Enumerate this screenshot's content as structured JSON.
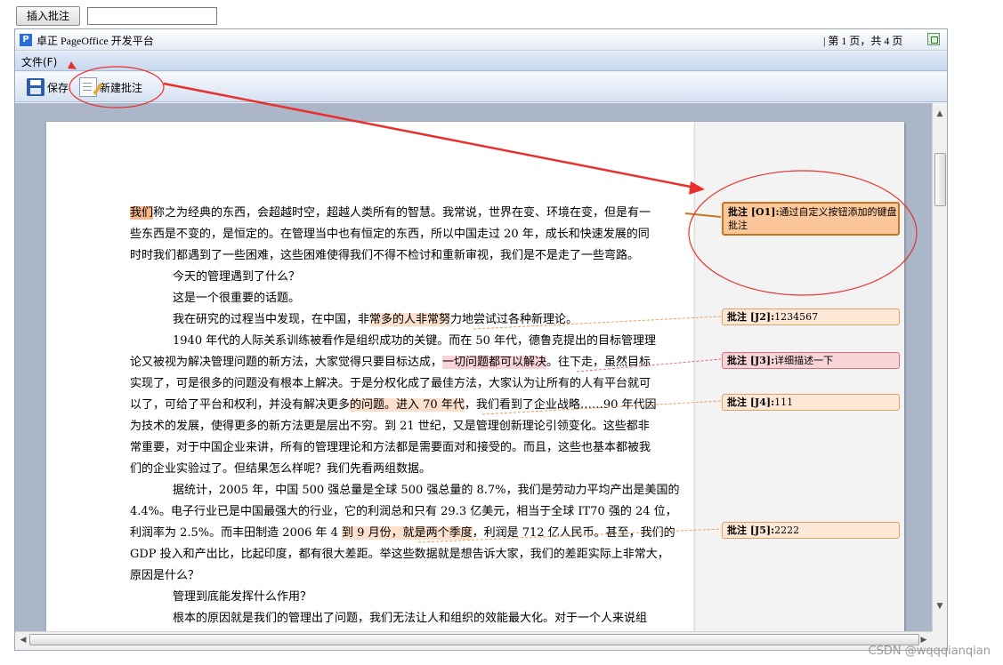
{
  "top": {
    "insert_button": "插入批注",
    "input_value": ""
  },
  "window": {
    "title": "卓正 PageOffice 开发平台",
    "page_info": "| 第 1 页，共 4 页",
    "menu_file": "文件(F)",
    "toolbar": {
      "save": "保存",
      "new_comment": "新建批注"
    }
  },
  "document": {
    "paragraphs": [
      [
        "我们",
        "称之为经典的东西，会超越时空，超越人类所有的智慧。我常说，世界在变、环境在变，但是有一"
      ],
      [
        "些东西是不变的，是恒定的。在管理当中也有恒定的东西，所以中国走过 20 年，成长和快速发展的同"
      ],
      [
        "时时我们都遇到了一些困难，这些困难使得我们不得不检讨和重新审视，我们是不是走了一些弯路。"
      ],
      [
        "今天的管理遇到了什么？"
      ],
      [
        "这是一个很重要的话题。"
      ],
      [
        "我在研究的过程当中发现，在中国，非",
        "常多的人非常努",
        "力地尝试过各种新理论。"
      ],
      [
        "1940 年代的人际关系训练被看作是组织成功的关键。而在 50 年代，德鲁克提出的目标管理理"
      ],
      [
        "论又被视为解决管理问题的新方法，大家觉得只要目标达成，",
        "一切问题都可以解决",
        "。往下走，虽然目标"
      ],
      [
        "实现了，可是很多的问题没有根本上解决。于是分权化成了最佳方法，大家认为让所有的人有平台就可"
      ],
      [
        "以了，可给了平台和权利，并没有解决更多",
        "的问题。进入 70 年代",
        "，我们看到了企业战略……90 年代因"
      ],
      [
        "为技术的发展，使得更多的新方法更是层出不穷。到 21 世纪，又是管理创新理论引领变化。这些都非"
      ],
      [
        "常重要，对于中国企业来讲，所有的管理理论和方法都是需要面对和接受的。而且，这些也基本都被我"
      ],
      [
        "们的企业实验过了。但结果怎么样呢？我们先看两组数据。"
      ],
      [
        "据统计，2005 年，中国 500 强总量是全球 500 强总量的 8.7%，我们是劳动力平均产出是美国的"
      ],
      [
        "4.4%。电子行业已是中国最强大的行业，它的利润总和只有 29.3 亿美元，相当于全球 IT70 强的 24 位，"
      ],
      [
        "利润率为 2.5%。而丰田制造 2006 年 4 ",
        "到 9 月份，就是两个季度",
        "，利润是 712 亿人民币。甚至，我们的"
      ],
      [
        "GDP 投入和产出比，比起印度，都有很大差距。举这些数据就是想告诉大家，我们的差距实际上非常大，"
      ],
      [
        "原因是什么？"
      ],
      [
        "管理到底能发挥什么作用？"
      ],
      [
        "根本的原因就是我们的管理出了问题，我们无法让人和组织的效能最大化。对于一个人来说组"
      ]
    ],
    "comments": [
      {
        "tag": "批注 [O1]:",
        "text": "通过自定义按钮添加的键盘批注"
      },
      {
        "tag": "批注 [J2]:",
        "text": "1234567"
      },
      {
        "tag": "批注 [J3]:",
        "text": "详细描述一下"
      },
      {
        "tag": "批注 [J4]:",
        "text": "111"
      },
      {
        "tag": "批注 [J5]:",
        "text": "2222"
      }
    ]
  },
  "watermark": "CSDN @wqqqianqian",
  "colors": {
    "annotation_red": "#e8302d",
    "comment_fill": "#fde7d6",
    "comment_border": "#e3a065",
    "highlight": "#fde0cc"
  },
  "icons": [
    "app-logo-icon",
    "maximize-icon",
    "save-floppy-icon",
    "new-comment-icon",
    "scroll-up-icon",
    "scroll-down-icon",
    "scroll-left-icon",
    "scroll-right-icon"
  ]
}
